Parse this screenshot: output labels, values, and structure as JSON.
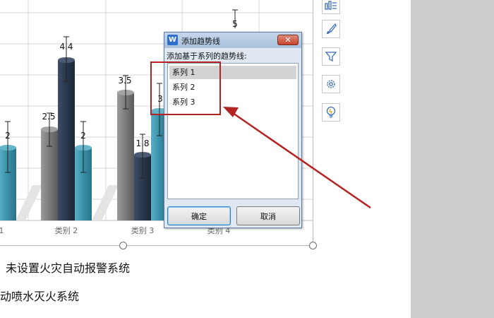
{
  "chart": {
    "categories": [
      "1",
      "类别 2",
      "类别 3",
      "类别 4"
    ],
    "bars": [
      {
        "label": "2"
      },
      {
        "label": "2.5"
      },
      {
        "label": "4.4"
      },
      {
        "label": "2"
      },
      {
        "label": "3.5"
      },
      {
        "label": "1.8"
      },
      {
        "label": "3"
      },
      {
        "label": "5"
      }
    ],
    "colors": {
      "gray": "#7a7a7a",
      "navy": "#2b3a4f",
      "teal": "#3a93ab"
    }
  },
  "dialog": {
    "app_icon": "W",
    "title": "添加趋势线",
    "close_label": "✕",
    "prompt": "添加基于系列的趋势线:",
    "series": [
      "系列 1",
      "系列 2",
      "系列 3"
    ],
    "selected_index": 0,
    "ok_label": "确定",
    "cancel_label": "取消"
  },
  "side_toolbar": [
    {
      "icon": "chart-elements-icon"
    },
    {
      "icon": "brush-icon"
    },
    {
      "icon": "filter-icon"
    },
    {
      "icon": "gear-icon"
    },
    {
      "icon": "lightbulb-icon"
    }
  ],
  "document": {
    "line1": "未设置火灾自动报警系统",
    "line2": "动喷水灭火系统"
  },
  "annotation_color": "#b52222"
}
